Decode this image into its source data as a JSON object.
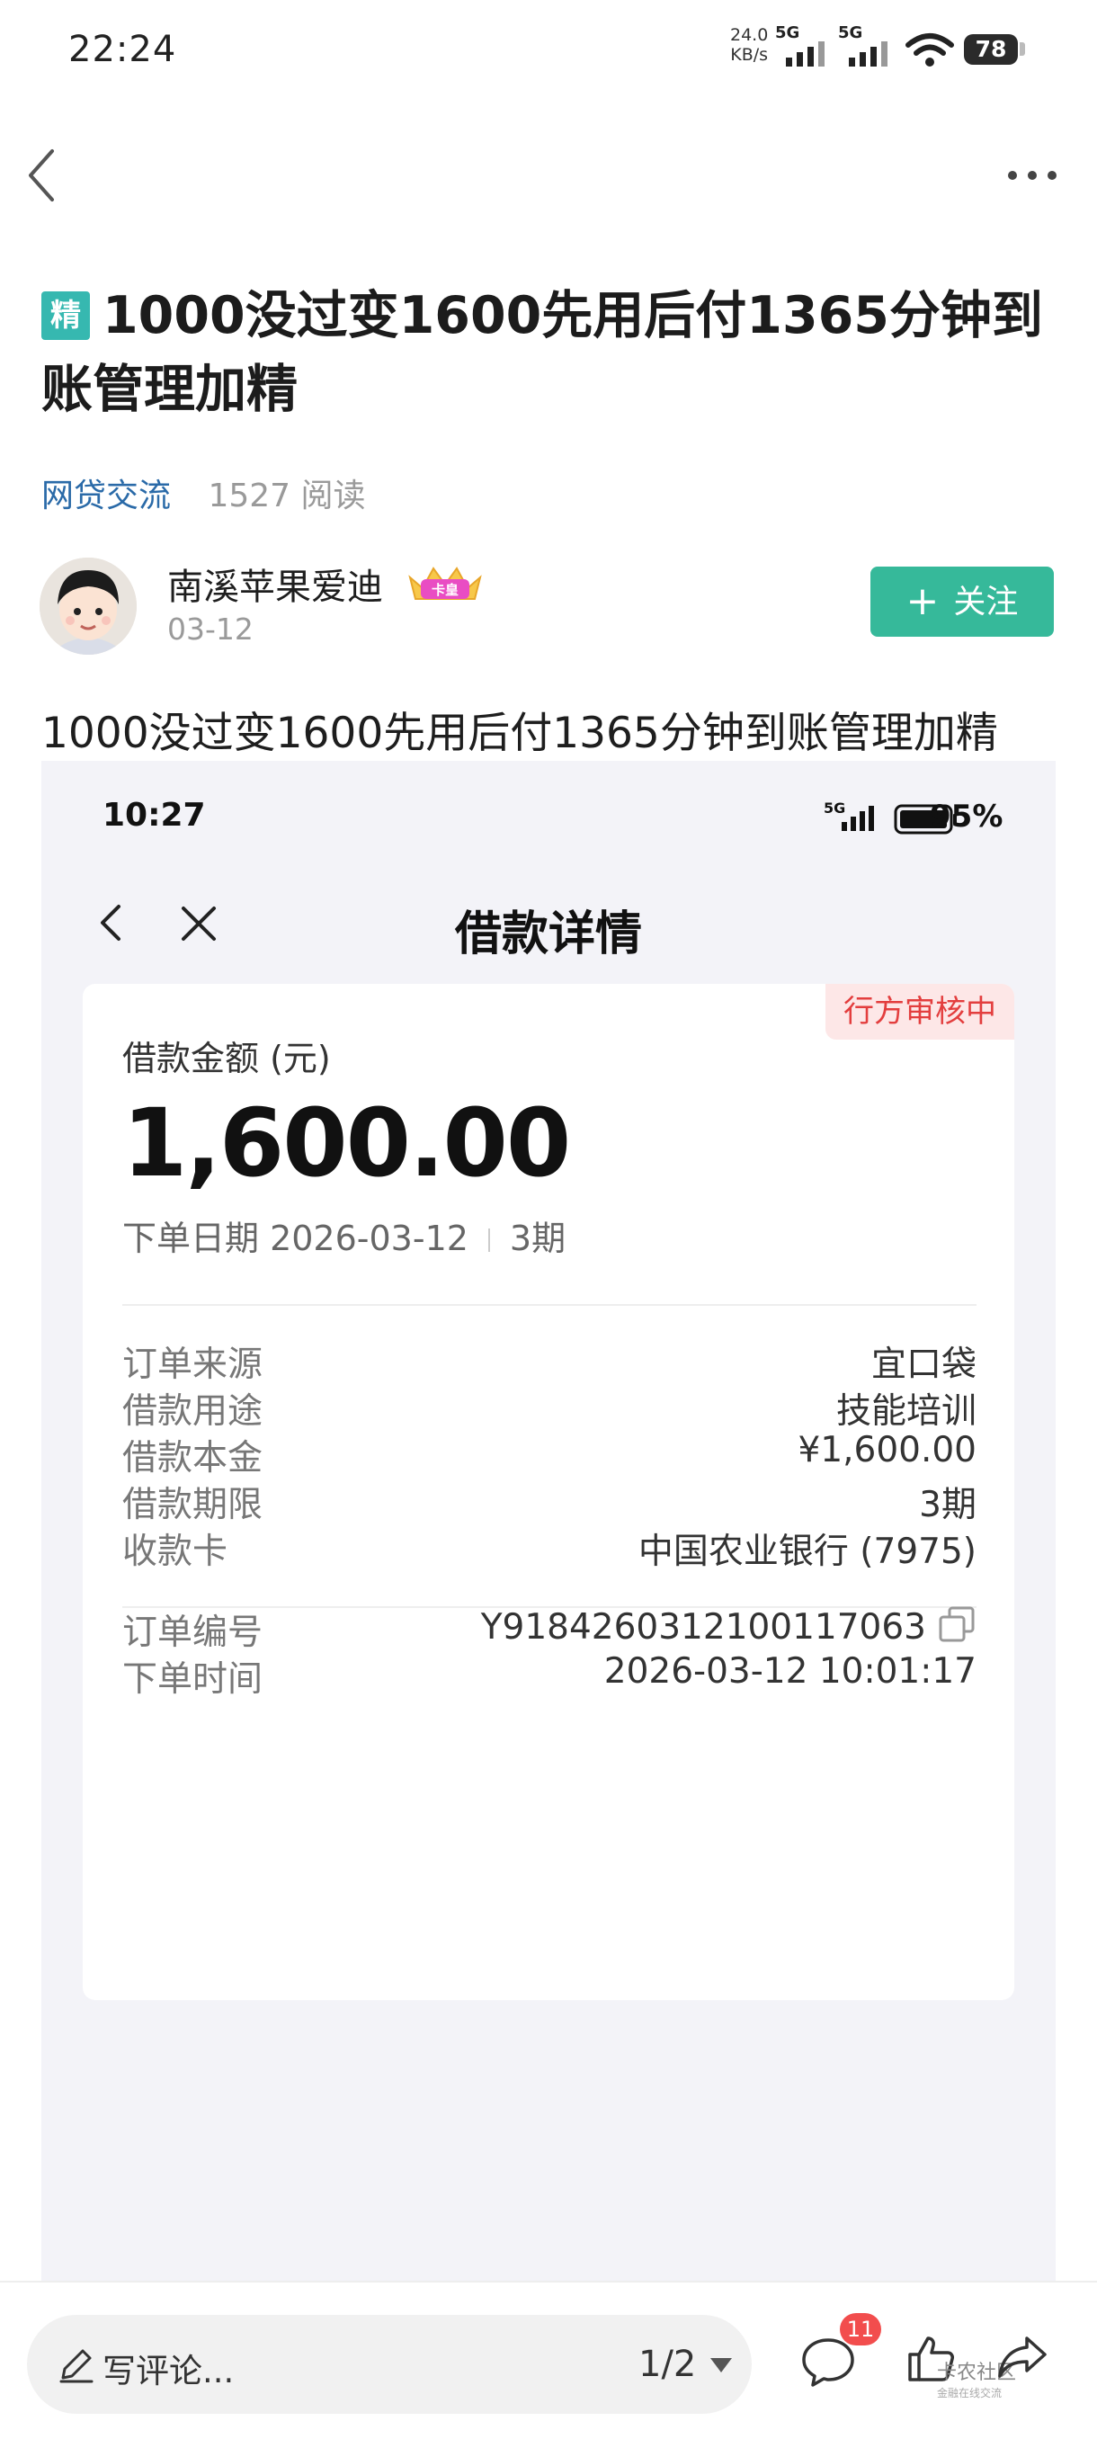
{
  "status_bar": {
    "time": "22:24",
    "speed_value": "24.0",
    "speed_unit": "KB/s",
    "network_1": "5G",
    "network_2": "5G",
    "battery": "78"
  },
  "post": {
    "badge": "精",
    "title": "1000没过变1600先用后付1365分钟到账管理加精",
    "category": "网贷交流",
    "reads": "1527 阅读",
    "body_text": "1000没过变1600先用后付1365分钟到账管理加精"
  },
  "author": {
    "name": "南溪苹果爱迪",
    "level_badge": "卡皇",
    "date": "03-12",
    "follow_label": "关注"
  },
  "screenshot": {
    "time": "10:27",
    "network": "5G",
    "battery_pct": "95%",
    "title": "借款详情",
    "status_tag": "行方审核中",
    "amount_label": "借款金额 (元)",
    "amount_value": "1,600.00",
    "order_date": "下单日期 2026-03-12",
    "periods": "3期",
    "details": [
      {
        "label": "订单来源",
        "value": "宜口袋"
      },
      {
        "label": "借款用途",
        "value": "技能培训"
      },
      {
        "label": "借款本金",
        "value": "¥1,600.00"
      },
      {
        "label": "借款期限",
        "value": "3期"
      },
      {
        "label": "收款卡",
        "value": "中国农业银行 (7975)"
      }
    ],
    "order_no_label": "订单编号",
    "order_no": "Y9184260312100117063",
    "order_time_label": "下单时间",
    "order_time": "2026-03-12 10:01:17"
  },
  "bottom_bar": {
    "comment_placeholder": "写评论...",
    "page_indicator": "1/2",
    "comment_count": "11",
    "watermark": "卡农社区",
    "watermark_sub": "金融在线交流"
  },
  "colors": {
    "accent": "#36b99a",
    "badge": "#36b8b0",
    "category_link": "#2a6aa8",
    "status_tag_text": "#e33e3e",
    "status_tag_bg": "#fde7e7",
    "notification": "#f24d4d"
  }
}
